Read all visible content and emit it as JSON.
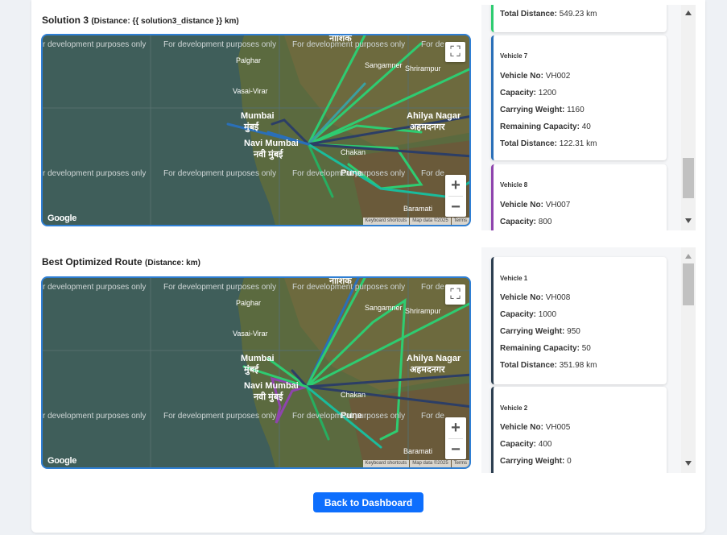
{
  "solution3": {
    "title": "Solution 3",
    "distance_text": "(Distance: {{ solution3_distance }} km)"
  },
  "best": {
    "title": "Best Optimized Route",
    "distance_text": "(Distance: km)"
  },
  "map": {
    "dev_text": "For development purposes only",
    "dev_text_cut": "r development purposes only",
    "dev_text_edge": "For de",
    "google": "Google",
    "keyboard": "Keyboard shortcuts",
    "map_data": "Map data ©2025",
    "terms": "Terms",
    "zoom_in": "+",
    "zoom_out": "−",
    "fullscreen": "⛶",
    "places": {
      "mumbai": "Mumbai",
      "mumbai_mr": "मुंबई",
      "navi_mumbai": "Navi Mumbai",
      "navi_mumbai_mr": "नवी मुंबई",
      "ahilya": "Ahilya Nagar",
      "ahilya_mr": "अहमदनगर",
      "pune": "Pune",
      "pune_mr": "पुणे",
      "vasai": "Vasai-Virar",
      "palghar": "Palghar",
      "chakan": "Chakan",
      "shrirampur": "Shrirampur",
      "sangamner": "Sangamner",
      "baramati": "Baramati",
      "nashik": "नाशिक"
    }
  },
  "panel_top": {
    "partial_total_label": "Total Distance:",
    "partial_total_value": "549.23 km",
    "vehicles": [
      {
        "title": "Vehicle 7",
        "vehicle_no": "VH002",
        "capacity": "1200",
        "carrying_weight": "1160",
        "remaining_capacity": "40",
        "total_distance": "122.31 km",
        "color": "#2a6fb8"
      },
      {
        "title": "Vehicle 8",
        "vehicle_no": "VH007",
        "capacity": "800",
        "color": "#8e44ad"
      }
    ]
  },
  "panel_bottom": {
    "vehicles": [
      {
        "title": "Vehicle 1",
        "vehicle_no": "VH008",
        "capacity": "1000",
        "carrying_weight": "950",
        "remaining_capacity": "50",
        "total_distance": "351.98 km",
        "color": "#2c3e50"
      },
      {
        "title": "Vehicle 2",
        "vehicle_no": "VH005",
        "capacity": "400",
        "carrying_weight": "0",
        "color": "#2c3e50"
      }
    ]
  },
  "labels": {
    "vehicle_no": "Vehicle No:",
    "capacity": "Capacity:",
    "carrying_weight": "Carrying Weight:",
    "remaining_capacity": "Remaining Capacity:",
    "total_distance": "Total Distance:"
  },
  "back_button": "Back to Dashboard",
  "colors": {
    "accent": "#0d6efd",
    "map_border": "#2f7fd4",
    "route_green": "#2ecc71",
    "route_blue": "#2a6fb8",
    "route_purple": "#8e44ad",
    "route_navy": "#2c3e66"
  }
}
